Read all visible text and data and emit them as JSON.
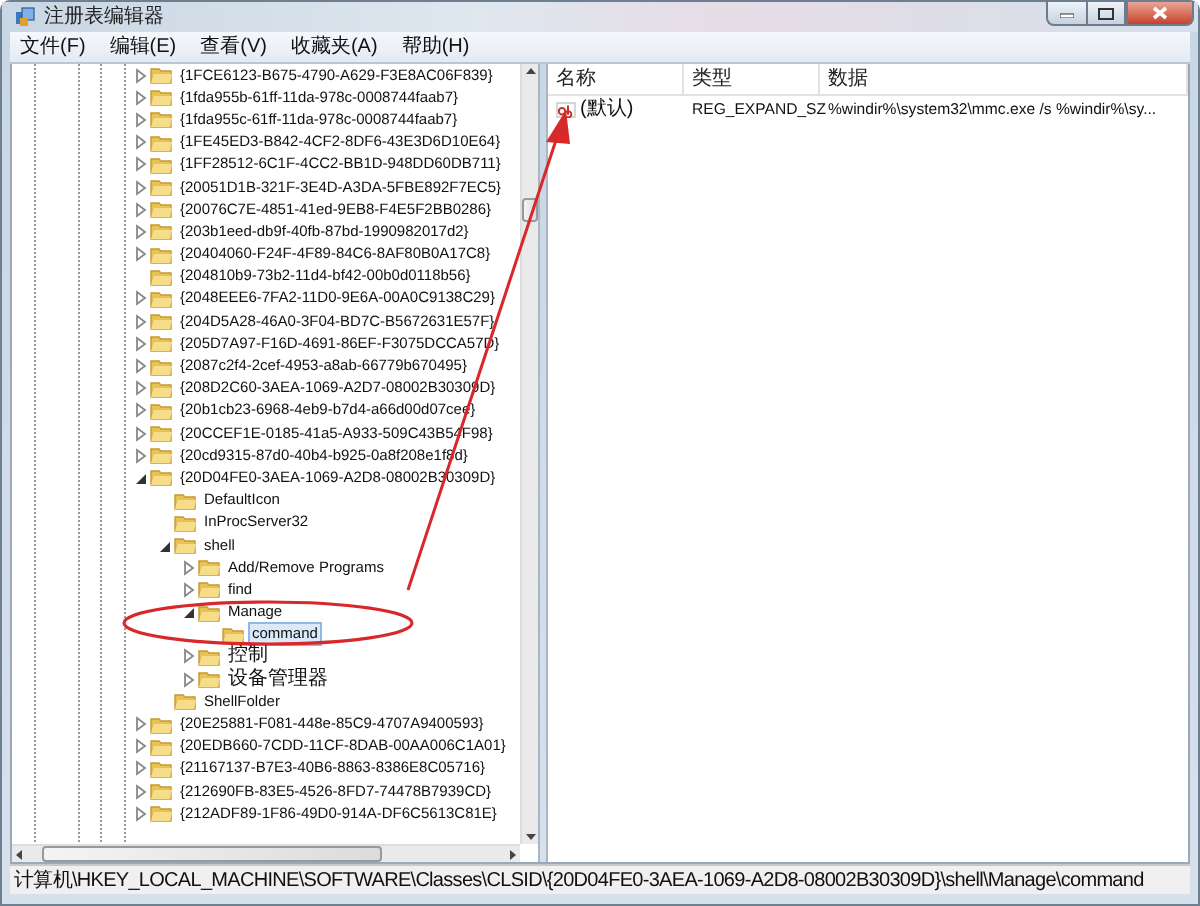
{
  "window": {
    "title": "注册表编辑器"
  },
  "menu": [
    "文件(F)",
    "编辑(E)",
    "查看(V)",
    "收藏夹(A)",
    "帮助(H)"
  ],
  "tree": {
    "nodes": [
      {
        "label": "{1FCE6123-B675-4790-A629-F3E8AC06F839}",
        "expandable": true,
        "selected": false
      },
      {
        "label": "{1fda955b-61ff-11da-978c-0008744faab7}",
        "expandable": true,
        "selected": false
      },
      {
        "label": "{1fda955c-61ff-11da-978c-0008744faab7}",
        "expandable": true,
        "selected": false
      },
      {
        "label": "{1FE45ED3-B842-4CF2-8DF6-43E3D6D10E64}",
        "expandable": true,
        "selected": false
      },
      {
        "label": "{1FF28512-6C1F-4CC2-BB1D-948DD60DB711}",
        "expandable": true,
        "selected": false
      },
      {
        "label": "{20051D1B-321F-3E4D-A3DA-5FBE892F7EC5}",
        "expandable": true,
        "selected": false
      },
      {
        "label": "{20076C7E-4851-41ed-9EB8-F4E5F2BB0286}",
        "expandable": true,
        "selected": false
      },
      {
        "label": "{203b1eed-db9f-40fb-87bd-1990982017d2}",
        "expandable": true,
        "selected": false
      },
      {
        "label": "{20404060-F24F-4F89-84C6-8AF80B0A17C8}",
        "expandable": true,
        "selected": false
      },
      {
        "label": "{204810b9-73b2-11d4-bf42-00b0d0118b56}",
        "expandable": false,
        "selected": false
      },
      {
        "label": "{2048EEE6-7FA2-11D0-9E6A-00A0C9138C29}",
        "expandable": true,
        "selected": false
      },
      {
        "label": "{204D5A28-46A0-3F04-BD7C-B5672631E57F}",
        "expandable": true,
        "selected": false
      },
      {
        "label": "{205D7A97-F16D-4691-86EF-F3075DCCA57D}",
        "expandable": true,
        "selected": false
      },
      {
        "label": "{2087c2f4-2cef-4953-a8ab-66779b670495}",
        "expandable": true,
        "selected": false
      },
      {
        "label": "{208D2C60-3AEA-1069-A2D7-08002B30309D}",
        "expandable": true,
        "selected": false
      },
      {
        "label": "{20b1cb23-6968-4eb9-b7d4-a66d00d07cee}",
        "expandable": true,
        "selected": false
      },
      {
        "label": "{20CCEF1E-0185-41a5-A933-509C43B54F98}",
        "expandable": true,
        "selected": false
      },
      {
        "label": "{20cd9315-87d0-40b4-b925-0a8f208e1f8d}",
        "expandable": true,
        "selected": false
      },
      {
        "label": "{20D04FE0-3AEA-1069-A2D8-08002B30309D}",
        "expandable": true,
        "selected": false,
        "children": [
          {
            "label": "DefaultIcon",
            "expandable": false,
            "selected": false
          },
          {
            "label": "InProcServer32",
            "expandable": false,
            "selected": false
          },
          {
            "label": "shell",
            "expandable": true,
            "selected": false,
            "children": [
              {
                "label": "Add/Remove Programs",
                "expandable": true,
                "selected": false
              },
              {
                "label": "find",
                "expandable": true,
                "selected": false
              },
              {
                "label": "Manage",
                "expandable": true,
                "selected": false,
                "children": [
                  {
                    "label": "command",
                    "expandable": false,
                    "selected": true
                  }
                ]
              },
              {
                "label": "控制",
                "expandable": true,
                "selected": false
              },
              {
                "label": "设备管理器",
                "expandable": true,
                "selected": false
              }
            ]
          },
          {
            "label": "ShellFolder",
            "expandable": false,
            "selected": false
          }
        ]
      },
      {
        "label": "{20E25881-F081-448e-85C9-4707A9400593}",
        "expandable": true,
        "selected": false
      },
      {
        "label": "{20EDB660-7CDD-11CF-8DAB-00AA006C1A01}",
        "expandable": true,
        "selected": false
      },
      {
        "label": "{21167137-B7E3-40B6-8863-8386E8C05716}",
        "expandable": true,
        "selected": false
      },
      {
        "label": "{212690FB-83E5-4526-8FD7-74478B7939CD}",
        "expandable": true,
        "selected": false
      },
      {
        "label": "{212ADF89-1F86-49D0-914A-DF6C5613C81E}",
        "expandable": true,
        "selected": false
      }
    ]
  },
  "values": {
    "columns": [
      "名称",
      "类型",
      "数据"
    ],
    "rows": [
      {
        "name": "(默认)",
        "type": "REG_EXPAND_SZ",
        "data": "%windir%\\system32\\mmc.exe /s %windir%\\sy..."
      }
    ]
  },
  "status_bar": "计算机\\HKEY_LOCAL_MACHINE\\SOFTWARE\\Classes\\CLSID\\{20D04FE0-3AEA-1069-A2D8-08002B30309D}\\shell\\Manage\\command"
}
